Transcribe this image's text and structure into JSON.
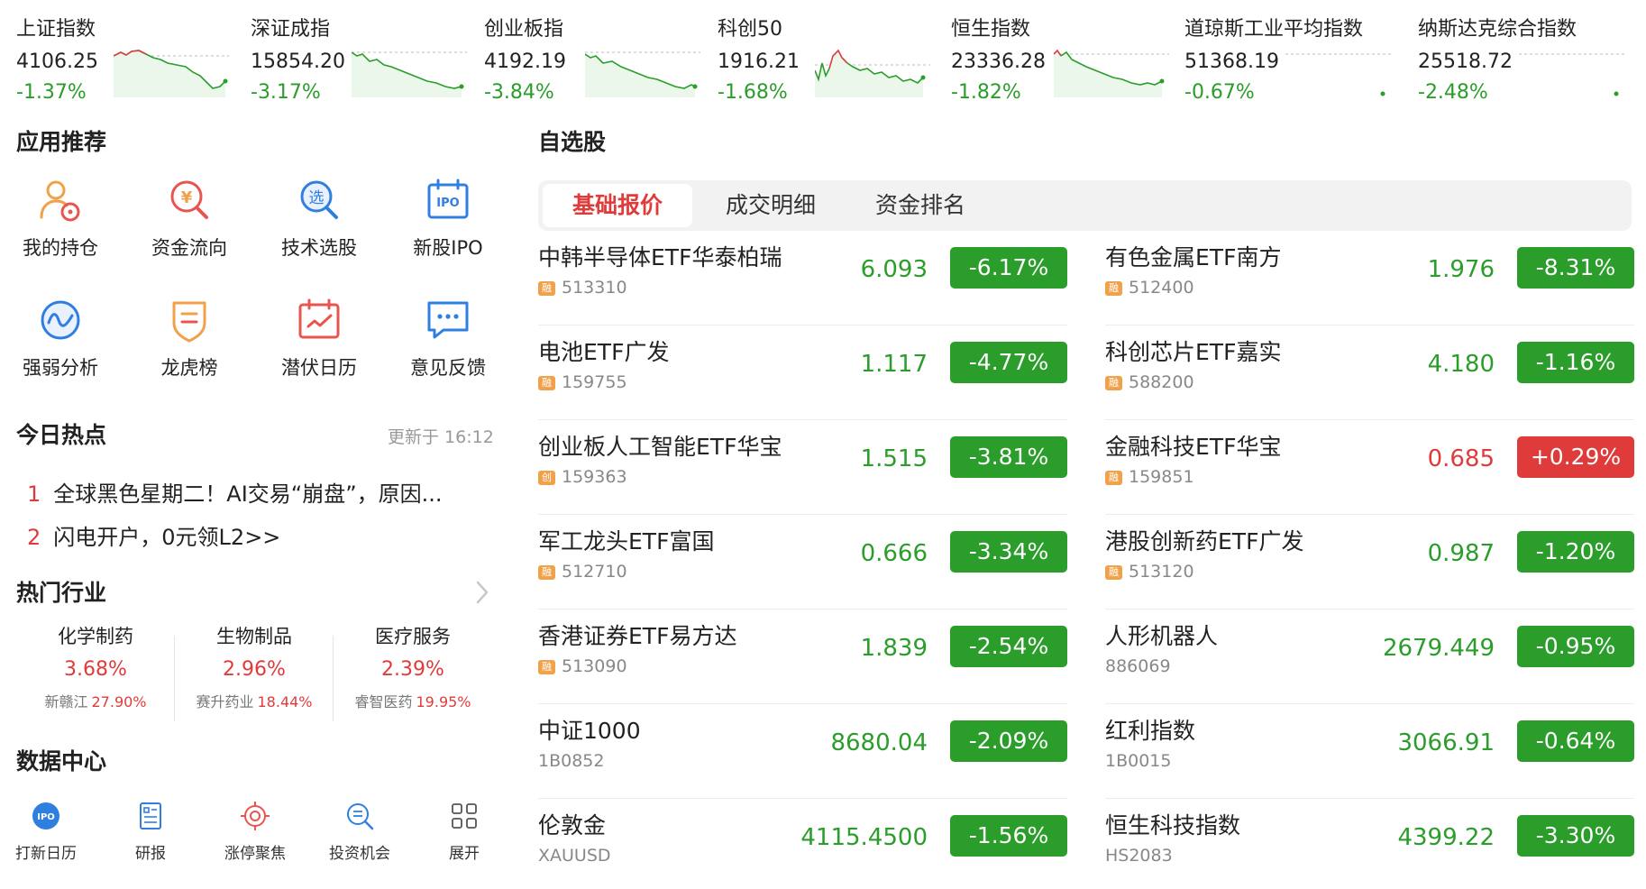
{
  "indices": [
    {
      "name": "上证指数",
      "price": "4106.25",
      "pct": "-1.37%"
    },
    {
      "name": "深证成指",
      "price": "15854.20",
      "pct": "-3.17%"
    },
    {
      "name": "创业板指",
      "price": "4192.19",
      "pct": "-3.84%"
    },
    {
      "name": "科创50",
      "price": "1916.21",
      "pct": "-1.68%"
    },
    {
      "name": "恒生指数",
      "price": "23336.28",
      "pct": "-1.82%"
    },
    {
      "name": "道琼斯工业平均指数",
      "price": "51368.19",
      "pct": "-0.67%"
    },
    {
      "name": "纳斯达克综合指数",
      "price": "25518.72",
      "pct": "-2.48%"
    }
  ],
  "apps": {
    "title": "应用推荐",
    "items": [
      {
        "label": "我的持仓",
        "icon": "user-portfolio-icon"
      },
      {
        "label": "资金流向",
        "icon": "money-flow-icon"
      },
      {
        "label": "技术选股",
        "icon": "stock-picker-icon"
      },
      {
        "label": "新股IPO",
        "icon": "ipo-calendar-icon"
      },
      {
        "label": "强弱分析",
        "icon": "strength-analysis-icon"
      },
      {
        "label": "龙虎榜",
        "icon": "dragon-tiger-badge-icon"
      },
      {
        "label": "潜伏日历",
        "icon": "calendar-check-icon"
      },
      {
        "label": "意见反馈",
        "icon": "feedback-chat-icon"
      }
    ]
  },
  "hot": {
    "title": "今日热点",
    "updated": "更新于 16:12",
    "items": [
      {
        "num": "1",
        "text": "全球黑色星期二！AI交易“崩盘”，原因..."
      },
      {
        "num": "2",
        "text": "闪电开户，0元领L2>>"
      }
    ]
  },
  "industries": {
    "title": "热门行业",
    "items": [
      {
        "name": "化学制药",
        "pct": "3.68%",
        "leader": "新赣江",
        "leader_pct": "27.90%"
      },
      {
        "name": "生物制品",
        "pct": "2.96%",
        "leader": "赛升药业",
        "leader_pct": "18.44%"
      },
      {
        "name": "医疗服务",
        "pct": "2.39%",
        "leader": "睿智医药",
        "leader_pct": "19.95%"
      }
    ]
  },
  "data_center": {
    "title": "数据中心",
    "items": [
      {
        "label": "打新日历",
        "icon": "ipo-badge-icon"
      },
      {
        "label": "研报",
        "icon": "report-icon"
      },
      {
        "label": "涨停聚焦",
        "icon": "target-icon"
      },
      {
        "label": "投资机会",
        "icon": "search-opportunity-icon"
      },
      {
        "label": "展开",
        "icon": "grid-expand-icon"
      }
    ]
  },
  "watchlist": {
    "title": "自选股",
    "tabs": [
      "基础报价",
      "成交明细",
      "资金排名"
    ],
    "left": [
      {
        "name": "中韩半导体ETF华泰柏瑞",
        "badge": "融",
        "code": "513310",
        "price": "6.093",
        "chg": "-6.17%"
      },
      {
        "name": "电池ETF广发",
        "badge": "融",
        "code": "159755",
        "price": "1.117",
        "chg": "-4.77%"
      },
      {
        "name": "创业板人工智能ETF华宝",
        "badge": "创",
        "code": "159363",
        "price": "1.515",
        "chg": "-3.81%"
      },
      {
        "name": "军工龙头ETF富国",
        "badge": "融",
        "code": "512710",
        "price": "0.666",
        "chg": "-3.34%"
      },
      {
        "name": "香港证券ETF易方达",
        "badge": "融",
        "code": "513090",
        "price": "1.839",
        "chg": "-2.54%"
      },
      {
        "name": "中证1000",
        "badge": "",
        "code": "1B0852",
        "price": "8680.04",
        "chg": "-2.09%"
      },
      {
        "name": "伦敦金",
        "badge": "",
        "code": "XAUUSD",
        "price": "4115.4500",
        "chg": "-1.56%"
      }
    ],
    "right": [
      {
        "name": "有色金属ETF南方",
        "badge": "融",
        "code": "512400",
        "price": "1.976",
        "chg": "-8.31%"
      },
      {
        "name": "科创芯片ETF嘉实",
        "badge": "融",
        "code": "588200",
        "price": "4.180",
        "chg": "-1.16%"
      },
      {
        "name": "金融科技ETF华宝",
        "badge": "融",
        "code": "159851",
        "price": "0.685",
        "chg": "+0.29%"
      },
      {
        "name": "港股创新药ETF广发",
        "badge": "融",
        "code": "513120",
        "price": "0.987",
        "chg": "-1.20%"
      },
      {
        "name": "人形机器人",
        "badge": "",
        "code": "886069",
        "price": "2679.449",
        "chg": "-0.95%"
      },
      {
        "name": "红利指数",
        "badge": "",
        "code": "1B0015",
        "price": "3066.91",
        "chg": "-0.64%"
      },
      {
        "name": "恒生科技指数",
        "badge": "",
        "code": "HS2083",
        "price": "4399.22",
        "chg": "-3.30%"
      }
    ]
  },
  "colors": {
    "up": "#e03b3b",
    "down": "#2a9d2a",
    "icon_orange": "#f0a14a",
    "icon_red": "#e8554e",
    "icon_blue": "#2f7fe0"
  }
}
